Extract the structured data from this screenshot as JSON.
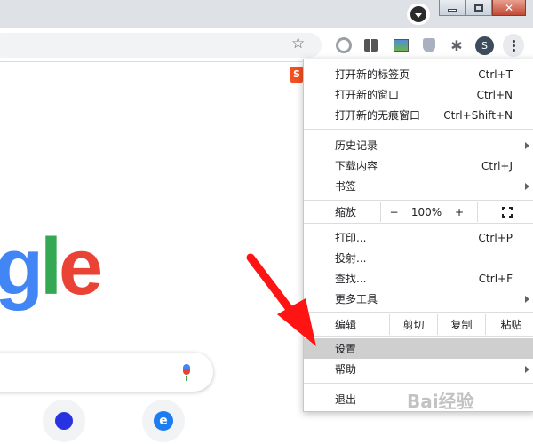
{
  "toolbar": {
    "avatar_letter": "S"
  },
  "window": {
    "close_glyph": "✕"
  },
  "page": {
    "logo_letters": [
      "g",
      "l",
      "e"
    ],
    "shortcut_letter": "S",
    "tile2_letter": "e"
  },
  "menu": {
    "new_tab": {
      "label": "打开新的标签页",
      "shortcut": "Ctrl+T"
    },
    "new_window": {
      "label": "打开新的窗口",
      "shortcut": "Ctrl+N"
    },
    "new_incognito": {
      "label": "打开新的无痕窗口",
      "shortcut": "Ctrl+Shift+N"
    },
    "history": {
      "label": "历史记录"
    },
    "downloads": {
      "label": "下载内容",
      "shortcut": "Ctrl+J"
    },
    "bookmarks": {
      "label": "书签"
    },
    "zoom": {
      "label": "缩放",
      "minus": "−",
      "value": "100%",
      "plus": "+"
    },
    "print": {
      "label": "打印...",
      "shortcut": "Ctrl+P"
    },
    "cast": {
      "label": "投射..."
    },
    "find": {
      "label": "查找...",
      "shortcut": "Ctrl+F"
    },
    "more_tools": {
      "label": "更多工具"
    },
    "edit": {
      "label": "编辑",
      "cut": "剪切",
      "copy": "复制",
      "paste": "粘贴"
    },
    "settings": {
      "label": "设置"
    },
    "help": {
      "label": "帮助"
    },
    "exit": {
      "label": "退出"
    }
  },
  "watermark": {
    "text": "Bai经验"
  },
  "colors": {
    "arrow": "#ff1414",
    "highlight": "#cfcfcf"
  }
}
